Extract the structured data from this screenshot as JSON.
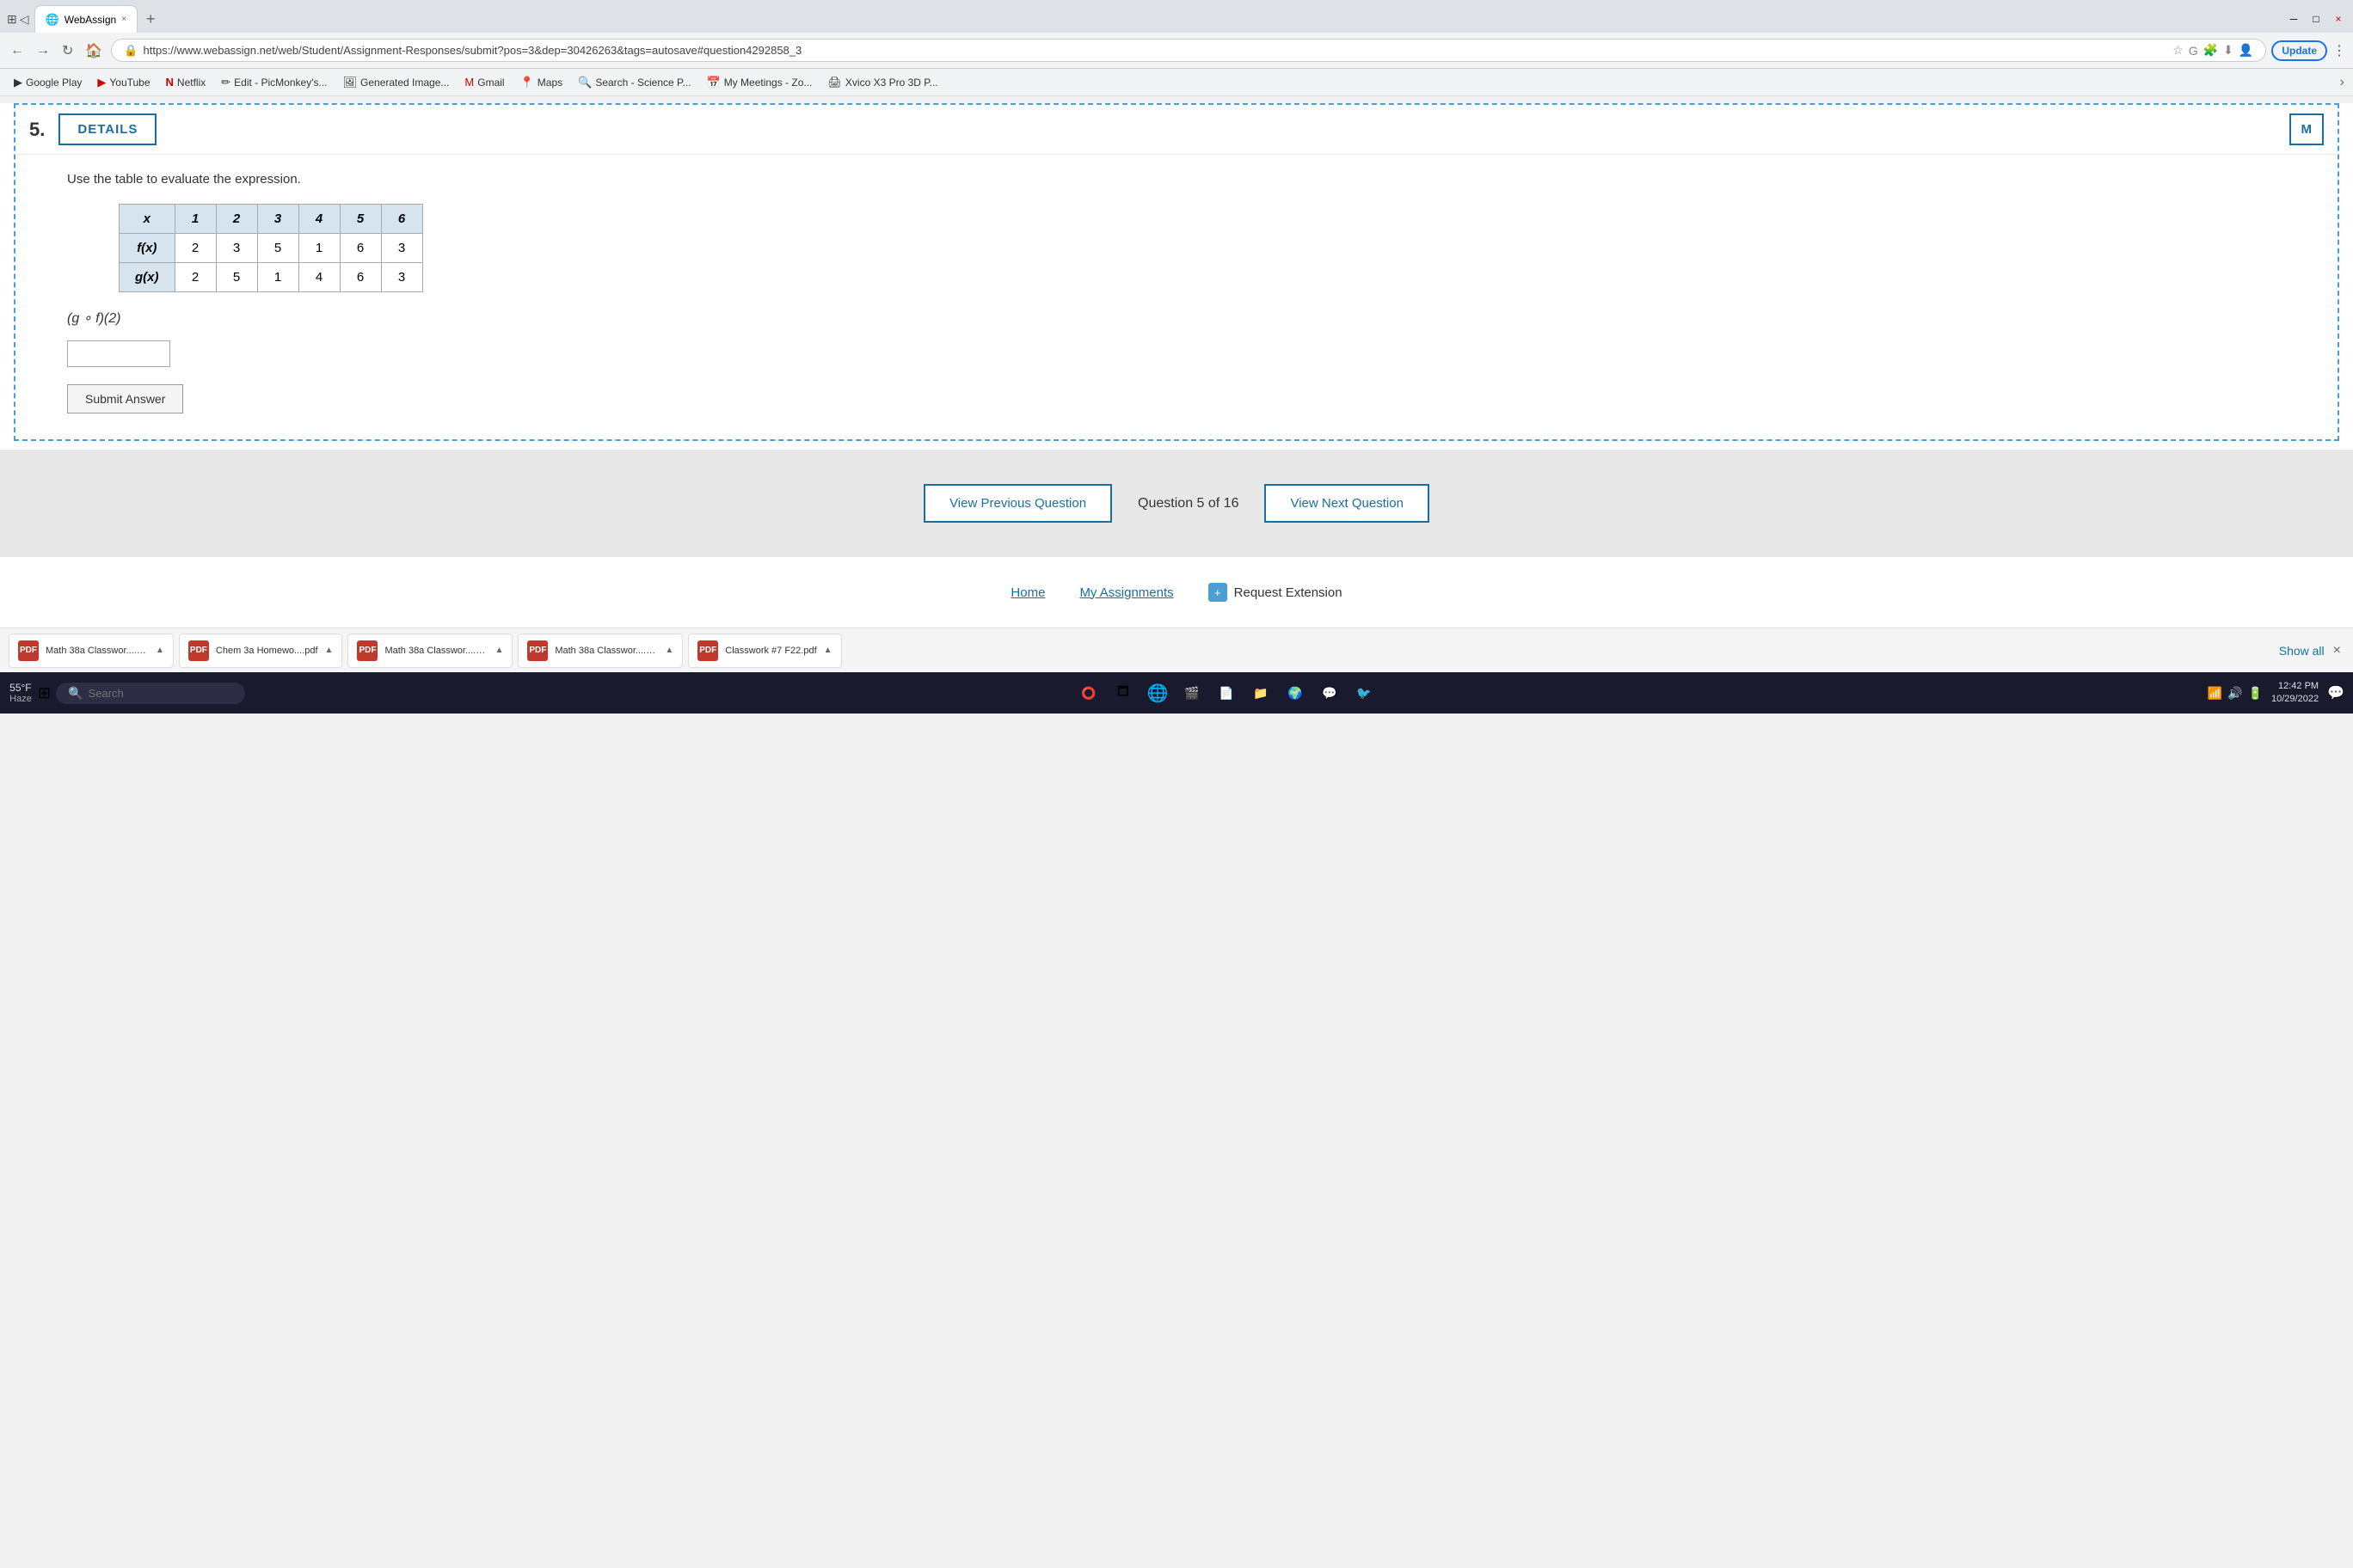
{
  "browser": {
    "tab_active": "WebAssign",
    "tab_close": "×",
    "tab_add": "+",
    "address": "https://www.webassign.net/web/Student/Assignment-Responses/submit?pos=3&dep=30426263&tags=autosave#question4292858_3",
    "update_label": "Update",
    "window_minimize": "─",
    "window_maximize": "□",
    "window_close": "×"
  },
  "bookmarks": [
    {
      "id": "google-play",
      "label": "Google Play",
      "icon": "▶"
    },
    {
      "id": "youtube",
      "label": "YouTube",
      "icon": "▶"
    },
    {
      "id": "netflix",
      "label": "Netflix",
      "icon": "N"
    },
    {
      "id": "picmonkey",
      "label": "Edit - PicMonkey's...",
      "icon": "✏"
    },
    {
      "id": "generated",
      "label": "Generated Image...",
      "icon": "🖼"
    },
    {
      "id": "gmail",
      "label": "Gmail",
      "icon": "M"
    },
    {
      "id": "maps",
      "label": "Maps",
      "icon": "📍"
    },
    {
      "id": "science",
      "label": "Search - Science P...",
      "icon": "🔍"
    },
    {
      "id": "meetings",
      "label": "My Meetings - Zo...",
      "icon": "📅"
    },
    {
      "id": "xvico",
      "label": "Xvico X3 Pro 3D P...",
      "icon": "🖨"
    }
  ],
  "question": {
    "number": "5.",
    "details_label": "DETAILS",
    "header_right": "M",
    "instruction": "Use the table to evaluate the expression.",
    "table": {
      "headers": [
        "x",
        "1",
        "2",
        "3",
        "4",
        "5",
        "6"
      ],
      "rows": [
        {
          "label": "f(x)",
          "values": [
            "2",
            "3",
            "5",
            "1",
            "6",
            "3"
          ]
        },
        {
          "label": "g(x)",
          "values": [
            "2",
            "5",
            "1",
            "4",
            "6",
            "3"
          ]
        }
      ]
    },
    "expression": "(g ∘ f)(2)",
    "answer_placeholder": "",
    "submit_label": "Submit Answer"
  },
  "navigation": {
    "prev_label": "View Previous Question",
    "next_label": "View Next Question",
    "counter": "Question 5 of 16"
  },
  "footer": {
    "home_label": "Home",
    "assignments_label": "My Assignments",
    "request_label": "Request Extension"
  },
  "downloads": [
    {
      "name": "Math 38a Classwor....pdf",
      "icon": "PDF"
    },
    {
      "name": "Chem 3a Homewo....pdf",
      "icon": "PDF"
    },
    {
      "name": "Math 38a Classwor....pdf",
      "icon": "PDF"
    },
    {
      "name": "Math 38a Classwor....pdf",
      "icon": "PDF"
    },
    {
      "name": "Classwork #7 F22.pdf",
      "icon": "PDF"
    }
  ],
  "downloads_show_all": "Show all",
  "taskbar": {
    "weather_temp": "55°F",
    "weather_desc": "Haze",
    "time": "12:42 PM",
    "date": "10/29/2022"
  }
}
